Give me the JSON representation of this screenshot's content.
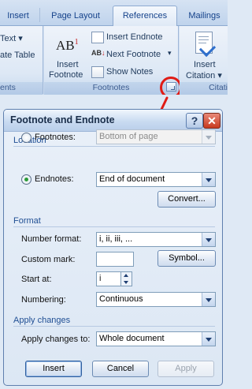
{
  "ribbon": {
    "tabs": [
      "Insert",
      "Page Layout",
      "References",
      "Mailings"
    ],
    "active_tab": "References",
    "left_group": {
      "items": [
        "Text",
        "ate Table"
      ],
      "caption": "ents"
    },
    "footnotes_group": {
      "insert_footnote": [
        "Insert",
        "Footnote"
      ],
      "insert_endnote": "Insert Endnote",
      "next_footnote": "Next Footnote",
      "show_notes": "Show Notes",
      "caption": "Footnotes"
    },
    "citations_group": {
      "insert_citation": [
        "Insert",
        "Citation"
      ],
      "caption": "Citati"
    },
    "annotation_color": "#e01c16"
  },
  "dialog": {
    "title": "Footnote and Endnote",
    "location": {
      "section": "Location",
      "footnotes_label": "Footnotes:",
      "footnotes_value": "Bottom of page",
      "endnotes_label": "Endnotes:",
      "endnotes_value": "End of document",
      "selected": "Endnotes",
      "convert": "Convert..."
    },
    "format": {
      "section": "Format",
      "number_format_label": "Number format:",
      "number_format_value": "i, ii, iii, ...",
      "custom_mark_label": "Custom mark:",
      "custom_mark_value": "",
      "symbol": "Symbol...",
      "start_at_label": "Start at:",
      "start_at_value": "i",
      "numbering_label": "Numbering:",
      "numbering_value": "Continuous"
    },
    "apply": {
      "section": "Apply changes",
      "apply_to_label": "Apply changes to:",
      "apply_to_value": "Whole document"
    },
    "buttons": {
      "insert": "Insert",
      "cancel": "Cancel",
      "apply": "Apply"
    }
  }
}
